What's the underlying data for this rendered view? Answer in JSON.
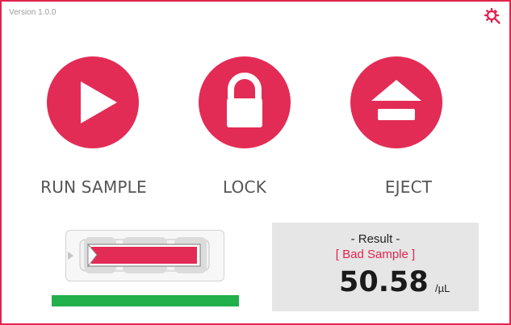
{
  "app": {
    "version": "Version 1.0.0",
    "accent_color": "#e22c55",
    "settings_icon": "settings-gear-icon"
  },
  "controls": [
    {
      "label": "RUN SAMPLE",
      "icon": "play-icon"
    },
    {
      "label": "LOCK",
      "icon": "lock-icon"
    },
    {
      "label": "EJECT",
      "icon": "eject-icon"
    }
  ],
  "cartridge": {
    "icon": "sample-cartridge-icon",
    "fill_color": "#e22c55"
  },
  "progress": {
    "fraction": 1.0,
    "color": "#22b04b"
  },
  "result": {
    "title": "- Result -",
    "status": "[ Bad Sample ]",
    "value": "50.58",
    "unit": "/µL"
  }
}
